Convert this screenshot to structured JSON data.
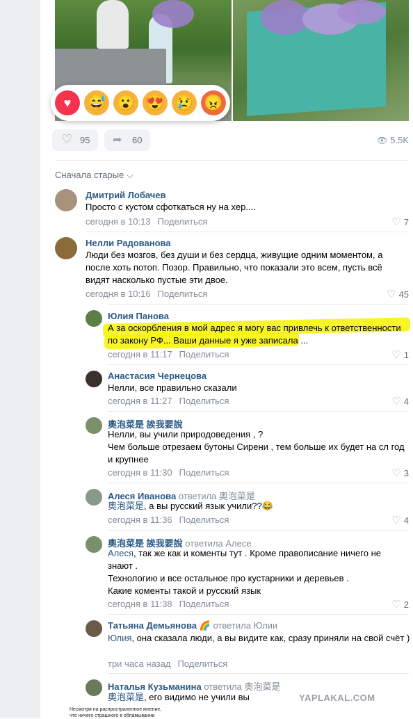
{
  "post": {
    "likes": "95",
    "shares": "60",
    "views": "5.5K",
    "reactions": [
      "heart-reaction",
      "laugh-reaction",
      "wow-reaction",
      "love-reaction",
      "sad-reaction",
      "angry-reaction"
    ]
  },
  "comments_header": {
    "sort_label": "Сначала старые ⌵"
  },
  "comments": [
    {
      "author": "Дмитрий Лобачев",
      "reply_to": "",
      "text": "Просто с кустом сфоткаться ну на хер....",
      "time": "сегодня в 10:13",
      "share": "Поделиться",
      "likes": "7"
    },
    {
      "author": "Нелли Радованова",
      "reply_to": "",
      "text": "Люди без мозгов, без души и без сердца, живущие одним моментом, а после хоть потоп. Позор. Правильно, что показали это всем, пусть всё видят насколько пустые эти двое.",
      "time": "сегодня в 10:16",
      "share": "Поделиться",
      "likes": "45"
    },
    {
      "author": "Юлия Панова",
      "reply_to": "",
      "text": "А за оскорбления в мой адрес я могу вас привлечь к ответственности по закону РФ... Ваши данные я уже записала ...",
      "time": "сегодня в 11:17",
      "share": "Поделиться",
      "likes": "1"
    },
    {
      "author": "Анастасия Чернецова",
      "reply_to": "",
      "text": "Нелли, все правильно сказали",
      "time": "сегодня в 11:27",
      "share": "Поделиться",
      "likes": "4"
    },
    {
      "author": "奧泡菜是 誒我要說",
      "reply_to": "",
      "text1": "Нелли, вы учили природоведения , ?",
      "text2": "Чем больше отрезаем бутоны Сирени , тем больше их будет на сл год и крупнее",
      "time": "сегодня в 11:30",
      "share": "Поделиться",
      "likes": "3"
    },
    {
      "author": "Алеся Иванова",
      "reply_to": "ответила 奧泡菜是",
      "mention": "奧泡菜是",
      "text": ", а вы русский язык учили??😂",
      "time": "сегодня в 11:36",
      "share": "Поделиться",
      "likes": "4"
    },
    {
      "author": "奧泡菜是 誒我要說",
      "reply_to": "ответила Алесе",
      "mention": "Алеся",
      "text1": ", так же как и коменты тут . Кроме правописание ничего не знают .",
      "text2": "Технологию и все остальное про кустарники и деревьев .",
      "text3": "Какие коменты такой и русский язык",
      "time": "сегодня в 11:38",
      "share": "Поделиться",
      "likes": "2"
    },
    {
      "author": "Татьяна Демьянова 🌈",
      "reply_to": "ответила Юлии",
      "mention": "Юлия",
      "text": ", она сказала люди, а вы видите как, сразу приняли на свой счёт )",
      "time": "три часа назад",
      "share": "Поделиться",
      "likes": ""
    },
    {
      "author": "Наталья Кузьманина",
      "reply_to": "ответила 奧泡菜是",
      "mention": "奧泡菜是",
      "text": ", его видимо не учили вы",
      "time": "",
      "share": "",
      "likes": ""
    }
  ],
  "watermark": "YAPLAKAL.COM",
  "overlay_caption": {
    "line1": "Несмотря на распространенное мнение,",
    "line2": "что ничего страшного в обламывании"
  },
  "colors": {
    "link": "#2a5885",
    "muted": "#818c99",
    "highlight": "#f7f300",
    "bg_gutter": "#edeef0"
  }
}
